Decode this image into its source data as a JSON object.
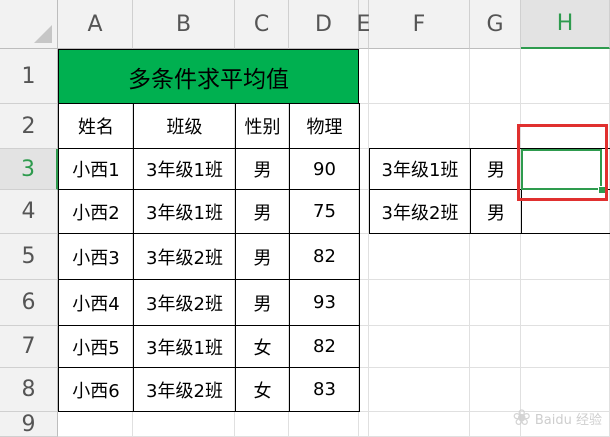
{
  "columns": [
    "A",
    "B",
    "C",
    "D",
    "E",
    "F",
    "G",
    "H"
  ],
  "rows": [
    "1",
    "2",
    "3",
    "4",
    "5",
    "6",
    "7",
    "8",
    "9"
  ],
  "active_column": "H",
  "active_row": "3",
  "title": "多条件求平均值",
  "table_headers": [
    "姓名",
    "班级",
    "性别",
    "物理"
  ],
  "table_rows": [
    [
      "小西1",
      "3年级1班",
      "男",
      "90"
    ],
    [
      "小西2",
      "3年级1班",
      "男",
      "75"
    ],
    [
      "小西3",
      "3年级2班",
      "男",
      "82"
    ],
    [
      "小西4",
      "3年级2班",
      "男",
      "93"
    ],
    [
      "小西5",
      "3年级1班",
      "女",
      "82"
    ],
    [
      "小西6",
      "3年级2班",
      "女",
      "83"
    ]
  ],
  "criteria_rows": [
    [
      "3年级1班",
      "男",
      ""
    ],
    [
      "3年级2班",
      "男",
      ""
    ]
  ],
  "colors": {
    "title_fill": "#00b050",
    "selection": "#2e9b4e",
    "highlight_box": "#e0302f"
  },
  "watermark": "Baidu 经验"
}
